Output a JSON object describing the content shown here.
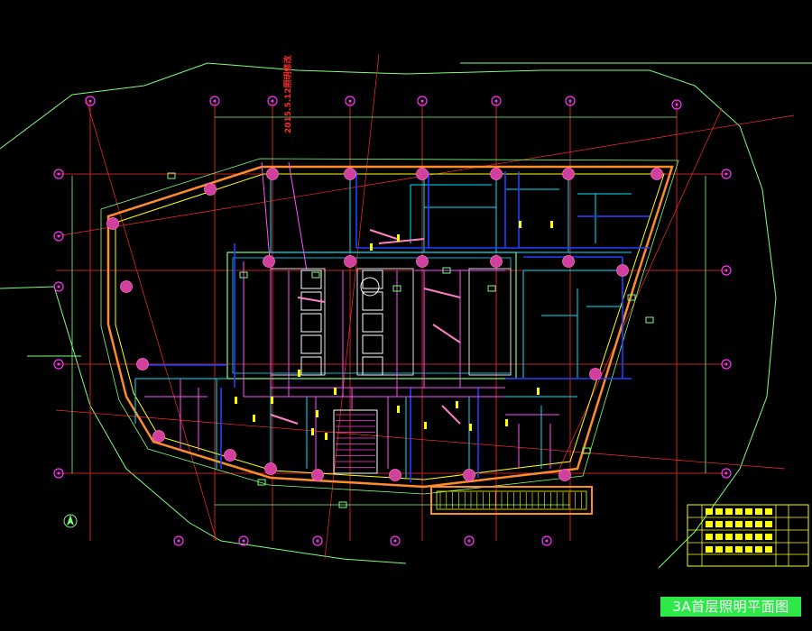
{
  "drawing": {
    "title": "3A首层照明平面图",
    "revision_note": "2015.5.12照明修改",
    "colors": {
      "background": "#000000",
      "wall_yellow": "#ffff00",
      "outline_green": "#7cff7c",
      "grid_red": "#ff2a2a",
      "axis_magenta": "#ff33ff",
      "room_cyan": "#00e5ff",
      "wire_blue": "#2040ff",
      "wire_magenta": "#ff50ff",
      "title_bg": "#2ee84a"
    },
    "icons": [
      "north-arrow-icon",
      "axis-bubble-icon"
    ]
  }
}
